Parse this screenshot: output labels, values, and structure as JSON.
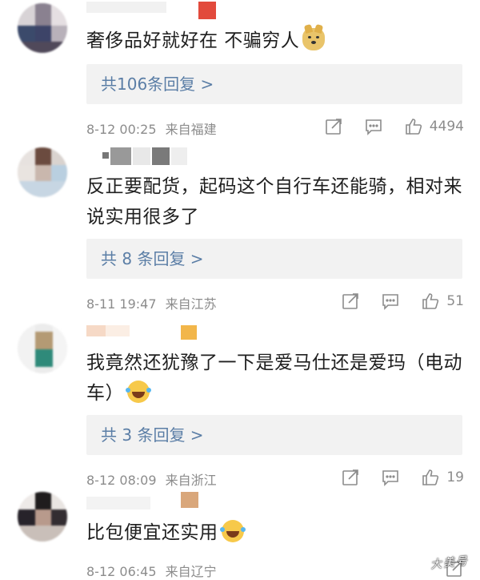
{
  "comments": [
    {
      "text": "奢侈品好就好在 不骗穷人",
      "emoji": "doge-emoji",
      "reply_label": "共106条回复 >",
      "date": "8-12 00:25",
      "location": "来自福建",
      "likes": "4494"
    },
    {
      "text": "反正要配货，起码这个自行车还能骑，相对来说实用很多了",
      "emoji": "",
      "reply_label": "共 8 条回复 >",
      "date": "8-11 19:47",
      "location": "来自江苏",
      "likes": "51"
    },
    {
      "text": "我竟然还犹豫了一下是爱马仕还是爱玛（电动车）",
      "emoji": "laughing-tears-emoji",
      "reply_label": "共 3 条回复 >",
      "date": "8-12 08:09",
      "location": "来自浙江",
      "likes": "19"
    },
    {
      "text": "比包便宜还实用",
      "emoji": "laughing-tears-emoji",
      "reply_label": "",
      "date": "8-12 06:45",
      "location": "来自辽宁",
      "likes": ""
    }
  ],
  "icons": {
    "share": "share-icon",
    "comment": "comment-icon",
    "like": "thumbs-up-icon"
  },
  "colors": {
    "reply_link": "#5b7ea6",
    "meta_text": "#8c8c8c",
    "reply_bg": "#f2f2f2"
  }
}
